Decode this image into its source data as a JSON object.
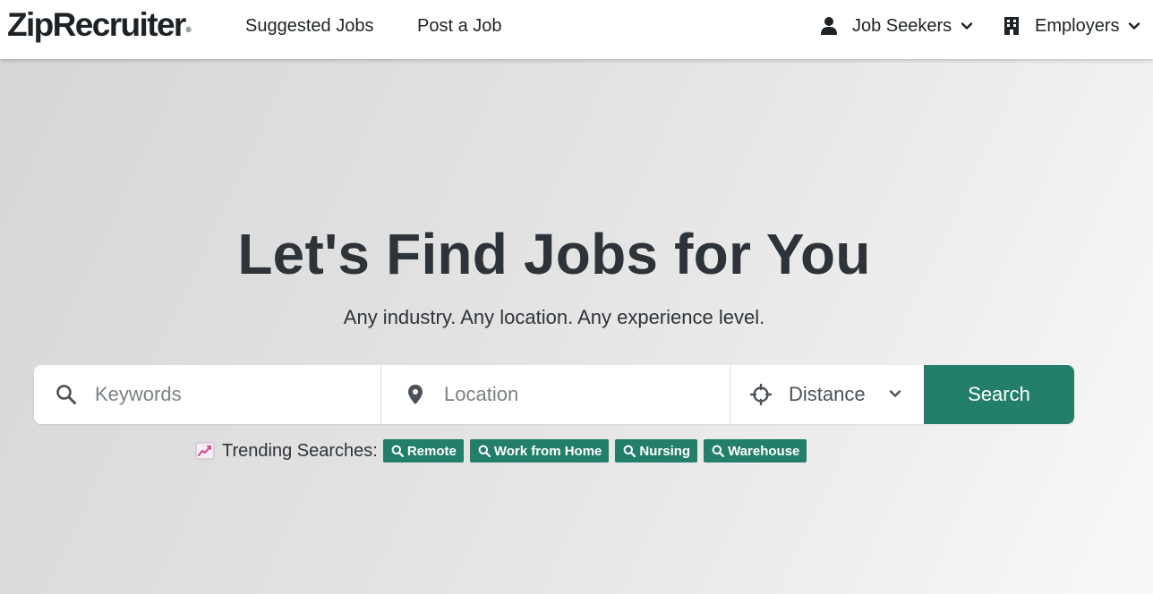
{
  "brand": {
    "name": "ZipRecruiter",
    "mark": "®"
  },
  "nav": {
    "suggested_jobs": "Suggested Jobs",
    "post_job": "Post a Job",
    "job_seekers": {
      "label": "Job Seekers",
      "icon": "person-icon"
    },
    "employers": {
      "label": "Employers",
      "icon": "building-icon"
    }
  },
  "hero": {
    "title": "Let's Find Jobs for You",
    "subtitle": "Any industry. Any location. Any experience level."
  },
  "search": {
    "keywords_placeholder": "Keywords",
    "location_placeholder": "Location",
    "distance_label": "Distance",
    "button_label": "Search"
  },
  "trending": {
    "label": "Trending Searches:",
    "chips": [
      "Remote",
      "Work from Home",
      "Nursing",
      "Warehouse"
    ]
  },
  "colors": {
    "accent": "#247f6a",
    "text": "#2d3339",
    "placeholder": "#7b8084"
  }
}
